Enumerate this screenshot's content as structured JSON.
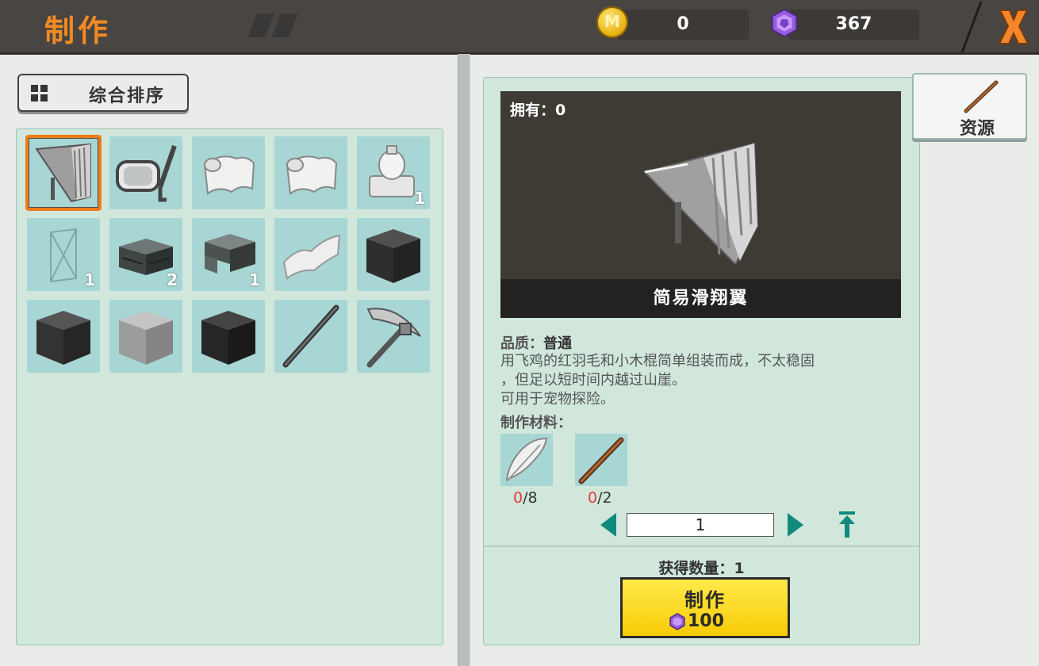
{
  "header": {
    "title": "制作",
    "coins": "0",
    "gems": "367",
    "coin_symbol": "M"
  },
  "sort": {
    "label": "综合排序"
  },
  "inventory": [
    {
      "item": "glider",
      "qty": "",
      "selected": true
    },
    {
      "item": "goggles",
      "qty": ""
    },
    {
      "item": "cloth",
      "qty": ""
    },
    {
      "item": "cloth",
      "qty": ""
    },
    {
      "item": "vase",
      "qty": "1"
    },
    {
      "item": "glass-frame",
      "qty": "1"
    },
    {
      "item": "stone-slab",
      "qty": "2"
    },
    {
      "item": "stone-stairs",
      "qty": "1"
    },
    {
      "item": "paper",
      "qty": ""
    },
    {
      "item": "dark-block",
      "qty": ""
    },
    {
      "item": "dark-block",
      "qty": ""
    },
    {
      "item": "light-block",
      "qty": ""
    },
    {
      "item": "dark-block",
      "qty": ""
    },
    {
      "item": "stick",
      "qty": ""
    },
    {
      "item": "pickaxe",
      "qty": ""
    }
  ],
  "detail": {
    "owned": "拥有：0",
    "name": "简易滑翔翼",
    "quality_label": "品质：",
    "quality_value": "普通",
    "desc_line1": "用飞鸡的红羽毛和小木棍简单组装而成，不太稳固",
    "desc_line2": "，但足以短时间内越过山崖。",
    "desc_line3": "可用于宠物探险。",
    "materials_label": "制作材料：",
    "materials": [
      {
        "item": "feather",
        "have": "0",
        "need": "/8"
      },
      {
        "item": "stick",
        "have": "0",
        "need": "/2"
      }
    ],
    "quantity": "1",
    "obtain": "获得数量：1",
    "craft_label": "制作",
    "craft_cost": "100"
  },
  "resource_tab": {
    "label": "资源"
  },
  "colors": {
    "accent": "#f38a22",
    "slot": "#a7d6d4",
    "panel": "#d1e7dc",
    "teal": "#0f8a7d",
    "button": "#f7cb06",
    "missing": "#e53c3c"
  }
}
